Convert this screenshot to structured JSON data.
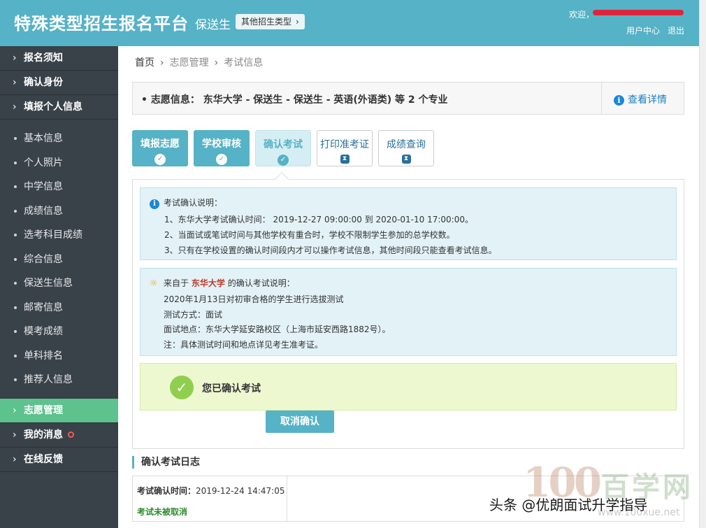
{
  "header": {
    "title": "特殊类型招生报名平台",
    "type": "保送生",
    "other_type_label": "其他招生类型",
    "welcome": "欢迎，",
    "user_center": "用户中心",
    "logout": "退出"
  },
  "sidebar": {
    "top_items": [
      {
        "label": "报名须知"
      },
      {
        "label": "确认身份"
      },
      {
        "label": "填报个人信息"
      }
    ],
    "sub_items": [
      {
        "label": "基本信息"
      },
      {
        "label": "个人照片"
      },
      {
        "label": "中学信息"
      },
      {
        "label": "成绩信息"
      },
      {
        "label": "选考科目成绩"
      },
      {
        "label": "综合信息"
      },
      {
        "label": "保送生信息"
      },
      {
        "label": "邮寄信息"
      },
      {
        "label": "模考成绩"
      },
      {
        "label": "单科排名"
      },
      {
        "label": "推荐人信息"
      }
    ],
    "bottom_items": [
      {
        "label": "志愿管理",
        "active": true
      },
      {
        "label": "我的消息"
      },
      {
        "label": "在线反馈"
      }
    ]
  },
  "breadcrumb": {
    "home": "首页",
    "section": "志愿管理",
    "current": "考试信息"
  },
  "choice": {
    "text": "志愿信息：  东华大学 - 保送生 - 保送生 - 英语(外语类) 等 2 个专业",
    "detail_label": "查看详情"
  },
  "steps": [
    {
      "label": "填报志愿",
      "state": "done"
    },
    {
      "label": "学校审核",
      "state": "done"
    },
    {
      "label": "确认考试",
      "state": "current"
    },
    {
      "label": "打印准考证",
      "state": "todo"
    },
    {
      "label": "成绩查询",
      "state": "todo"
    }
  ],
  "exam_notice": {
    "title": "考试确认说明：",
    "lines": [
      "1、东华大学考试确认时间： 2019-12-27 09:00:00 到 2020-01-10 17:00:00。",
      "2、当面试或笔试时间与其他学校有重合时，学校不限制学生参加的总学校数。",
      "3、只有在学校设置的确认时间段内才可以操作考试信息，其他时间段只能查看考试信息。"
    ]
  },
  "school_notice": {
    "prefix": "来自于",
    "school": "东华大学",
    "suffix": "的确认考试说明：",
    "lines": [
      "2020年1月13日对初审合格的学生进行选拔测试",
      "测试方式：面试",
      "面试地点：东华大学延安路校区（上海市延安西路1882号）。",
      "注：具体测试时间和地点详见考生准考证。"
    ]
  },
  "confirmed": {
    "text": "您已确认考试"
  },
  "cancel_button": "取消确认",
  "log": {
    "title": "确认考试日志",
    "time_label": "考试确认时间：",
    "time_value": "2019-12-24 14:47:05",
    "status": "考试未被取消"
  },
  "watermark": {
    "logo": "100",
    "cn": "百学网",
    "url": "www.100xue.net",
    "toutiao": "头条 @优朗面试升学指导"
  },
  "colors": {
    "accent": "#56b2c6",
    "sidebar_bg": "#3a4249",
    "active": "#5dc28d",
    "school_red": "#c0392b"
  }
}
